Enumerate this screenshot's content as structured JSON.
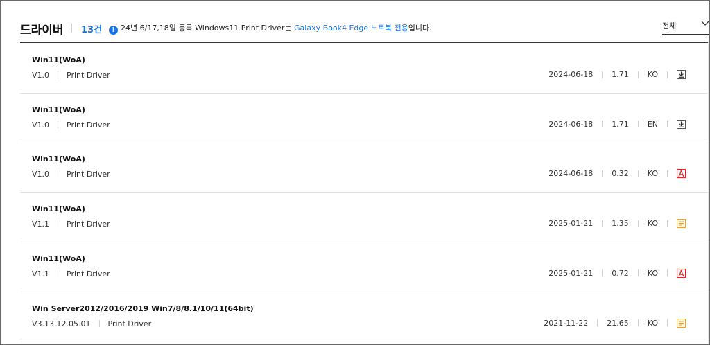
{
  "header": {
    "title": "드라이버",
    "count": "13건",
    "notice_prefix": "24년 6/17,18일 등록 Windows11 Print Driver는 ",
    "notice_link": "Galaxy Book4 Edge 노트북 전용",
    "notice_suffix": "입니다.",
    "filter_value": "전체"
  },
  "rows": [
    {
      "name": "Win11(WoA)",
      "version": "V1.0",
      "type": "Print Driver",
      "date": "2024-06-18",
      "size": "1.71",
      "lang": "KO",
      "icon": "download-icon"
    },
    {
      "name": "Win11(WoA)",
      "version": "V1.0",
      "type": "Print Driver",
      "date": "2024-06-18",
      "size": "1.71",
      "lang": "EN",
      "icon": "download-icon"
    },
    {
      "name": "Win11(WoA)",
      "version": "V1.0",
      "type": "Print Driver",
      "date": "2024-06-18",
      "size": "0.32",
      "lang": "KO",
      "icon": "pdf-icon"
    },
    {
      "name": "Win11(WoA)",
      "version": "V1.1",
      "type": "Print Driver",
      "date": "2025-01-21",
      "size": "1.35",
      "lang": "KO",
      "icon": "document-icon"
    },
    {
      "name": "Win11(WoA)",
      "version": "V1.1",
      "type": "Print Driver",
      "date": "2025-01-21",
      "size": "0.72",
      "lang": "KO",
      "icon": "pdf-icon"
    },
    {
      "name": "Win Server2012/2016/2019 Win7/8/8.1/10/11(64bit)",
      "version": "V3.13.12.05.01",
      "type": "Print Driver",
      "date": "2021-11-22",
      "size": "21.65",
      "lang": "KO",
      "icon": "document-icon"
    }
  ],
  "colors": {
    "accent": "#1a73d9",
    "pdf_red": "#d62b2b",
    "doc_orange": "#e0a34a"
  }
}
